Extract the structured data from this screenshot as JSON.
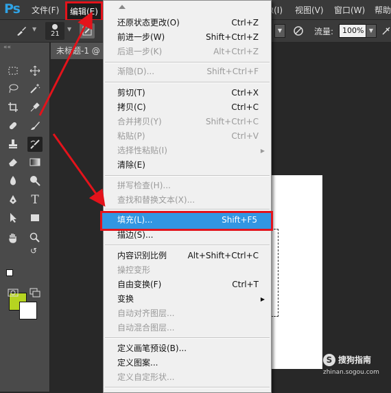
{
  "app": {
    "logo": "Ps"
  },
  "menubar": {
    "items_left": [
      "文件(F)",
      "编辑(E)"
    ],
    "items_right": [
      "像(I)",
      "视图(V)",
      "窗口(W)",
      "帮助"
    ]
  },
  "options_bar": {
    "brush_size": "21",
    "flow_label": "流量:",
    "flow_value": "100%"
  },
  "document": {
    "tab_title": "未标题-1 @"
  },
  "edit_menu": {
    "items": [
      {
        "label": "还原状态更改(O)",
        "shortcut": "Ctrl+Z",
        "enabled": true
      },
      {
        "label": "前进一步(W)",
        "shortcut": "Shift+Ctrl+Z",
        "enabled": true
      },
      {
        "label": "后退一步(K)",
        "shortcut": "Alt+Ctrl+Z",
        "enabled": false
      },
      {
        "label": "渐隐(D)...",
        "shortcut": "Shift+Ctrl+F",
        "enabled": false
      },
      {
        "label": "剪切(T)",
        "shortcut": "Ctrl+X",
        "enabled": true
      },
      {
        "label": "拷贝(C)",
        "shortcut": "Ctrl+C",
        "enabled": true
      },
      {
        "label": "合并拷贝(Y)",
        "shortcut": "Shift+Ctrl+C",
        "enabled": false
      },
      {
        "label": "粘贴(P)",
        "shortcut": "Ctrl+V",
        "enabled": false
      },
      {
        "label": "选择性粘贴(I)",
        "shortcut": "",
        "enabled": false,
        "submenu": true
      },
      {
        "label": "清除(E)",
        "shortcut": "",
        "enabled": true
      },
      {
        "label": "拼写检查(H)...",
        "shortcut": "",
        "enabled": false
      },
      {
        "label": "查找和替换文本(X)...",
        "shortcut": "",
        "enabled": false
      },
      {
        "label": "填充(L)...",
        "shortcut": "Shift+F5",
        "enabled": true,
        "highlighted": true
      },
      {
        "label": "描边(S)...",
        "shortcut": "",
        "enabled": true
      },
      {
        "label": "内容识别比例",
        "shortcut": "Alt+Shift+Ctrl+C",
        "enabled": true
      },
      {
        "label": "操控变形",
        "shortcut": "",
        "enabled": false
      },
      {
        "label": "自由变换(F)",
        "shortcut": "Ctrl+T",
        "enabled": true
      },
      {
        "label": "变换",
        "shortcut": "",
        "enabled": true,
        "submenu": true
      },
      {
        "label": "自动对齐图层...",
        "shortcut": "",
        "enabled": false
      },
      {
        "label": "自动混合图层...",
        "shortcut": "",
        "enabled": false
      },
      {
        "label": "定义画笔预设(B)...",
        "shortcut": "",
        "enabled": true
      },
      {
        "label": "定义图案...",
        "shortcut": "",
        "enabled": true
      },
      {
        "label": "定义自定形状...",
        "shortcut": "",
        "enabled": false
      }
    ]
  },
  "colors": {
    "foreground": "#b6d421",
    "background": "#ffffff",
    "highlight": "#3296e2",
    "annotation": "#e3131b"
  },
  "watermark": {
    "name": "搜狗指南",
    "url": "zhinan.sogou.com"
  }
}
